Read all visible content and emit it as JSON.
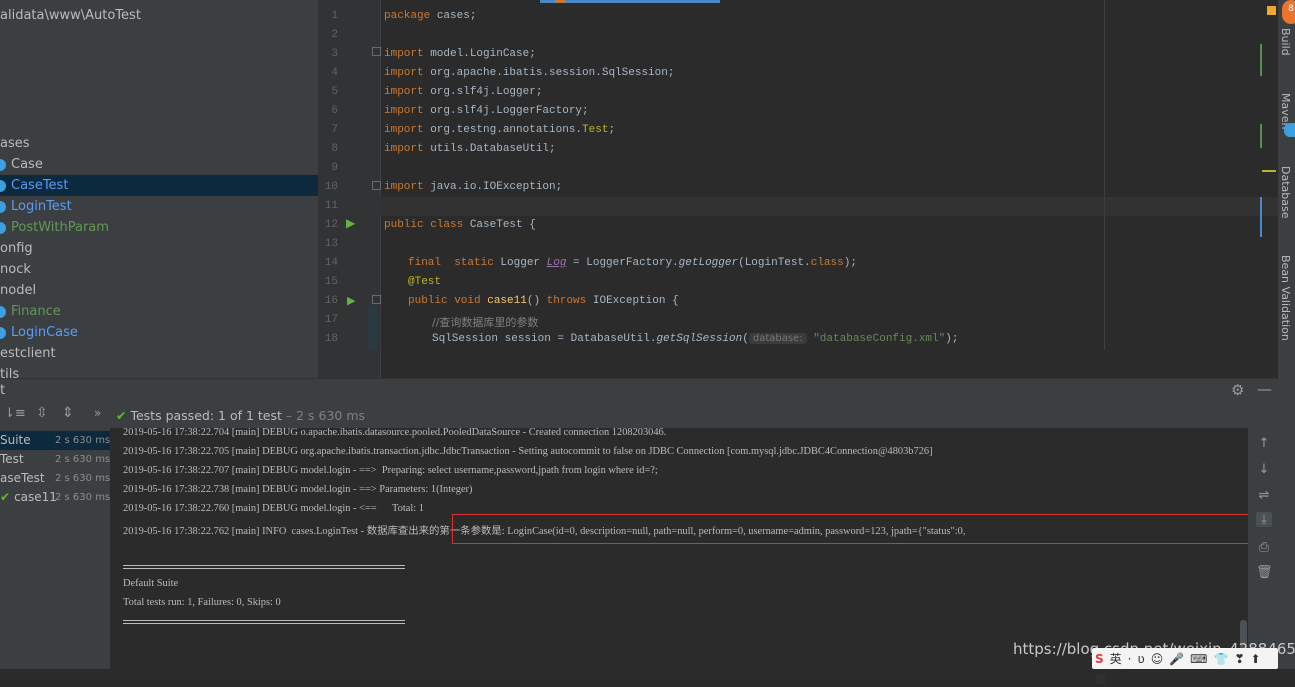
{
  "project": {
    "path": "alidata\\www\\AutoTest",
    "tree": [
      {
        "label": "ases",
        "style": "plain",
        "icon": false
      },
      {
        "label": "Case",
        "style": "plain",
        "icon": true
      },
      {
        "label": "CaseTest",
        "style": "blue",
        "icon": true,
        "selected": true
      },
      {
        "label": "LoginTest",
        "style": "blue",
        "icon": true
      },
      {
        "label": "PostWithParam",
        "style": "green",
        "icon": true
      },
      {
        "label": "onfig",
        "style": "plain",
        "icon": false
      },
      {
        "label": "nock",
        "style": "plain",
        "icon": false
      },
      {
        "label": "nodel",
        "style": "plain",
        "icon": false
      },
      {
        "label": "Finance",
        "style": "green",
        "icon": true
      },
      {
        "label": "LoginCase",
        "style": "blue",
        "icon": true
      },
      {
        "label": "estclient",
        "style": "plain",
        "icon": false
      },
      {
        "label": "tils",
        "style": "plain",
        "icon": false
      }
    ]
  },
  "editor": {
    "line_numbers": [
      "1",
      "2",
      "3",
      "4",
      "5",
      "6",
      "7",
      "8",
      "9",
      "10",
      "11",
      "12",
      "13",
      "14",
      "15",
      "16",
      "17",
      "18"
    ],
    "code": {
      "l1_kw": "package",
      "l1_rest": " cases;",
      "l3_kw": "import",
      "l3_rest": " model.LoginCase;",
      "l4_kw": "import",
      "l4_rest": " org.apache.ibatis.session.SqlSession;",
      "l5_kw": "import",
      "l5_rest": " org.slf4j.Logger;",
      "l6_kw": "import",
      "l6_rest": " org.slf4j.LoggerFactory;",
      "l7_kw": "import",
      "l7_rest": " org.testng.annotations.",
      "l7_ann": "Test",
      "l7_end": ";",
      "l8_kw": "import",
      "l8_rest": " utils.DatabaseUtil;",
      "l10_kw": "import",
      "l10_rest": " java.io.IOException;",
      "l12_kw": "public class",
      "l12_rest": " CaseTest {",
      "l14_kw": "final  static",
      "l14_a": " Logger ",
      "l14_var": "Log",
      "l14_b": " = LoggerFactory.",
      "l14_fn": "getLogger",
      "l14_c": "(LoginTest.",
      "l14_kw2": "class",
      "l14_d": ");",
      "l15_ann": "@Test",
      "l16_kw": "public void",
      "l16_fn": " case11",
      "l16_a": "() ",
      "l16_kw2": "throws",
      "l16_b": " IOException {",
      "l17_cmt": "//查询数据库里的参数",
      "l18_a": "SqlSession session = DatabaseUtil.",
      "l18_fn": "getSqlSession",
      "l18_b": "(",
      "l18_hint": "database:",
      "l18_str": " \"databaseConfig.xml\"",
      "l18_c": ");"
    }
  },
  "sidebar_right": {
    "badge": "8",
    "labels": [
      "Build",
      "Maven",
      "Database",
      "Bean Validation"
    ]
  },
  "run": {
    "header_tab": "t",
    "status_prefix": "Tests passed:",
    "status_count": "1 of 1 test",
    "status_time": "– 2 s 630 ms",
    "tree": [
      {
        "label": "Suite",
        "time": "2 s 630 ms",
        "selected": true
      },
      {
        "label": "Test",
        "time": "2 s 630 ms"
      },
      {
        "label": "aseTest",
        "time": "2 s 630 ms"
      },
      {
        "label": "case11",
        "time": "2 s 630 ms"
      }
    ],
    "log_lines": [
      "2019-05-16 17:38:22.704 [main] DEBUG o.apache.ibatis.datasource.pooled.PooledDataSource - Created connection 1208203046.",
      "2019-05-16 17:38:22.705 [main] DEBUG org.apache.ibatis.transaction.jdbc.JdbcTransaction - Setting autocommit to false on JDBC Connection [com.mysql.jdbc.JDBC4Connection@4803b726]",
      "2019-05-16 17:38:22.707 [main] DEBUG model.login - ==>  Preparing: select username,password,jpath from login where id=?;",
      "2019-05-16 17:38:22.738 [main] DEBUG model.login - ==> Parameters: 1(Integer)",
      "2019-05-16 17:38:22.760 [main] DEBUG model.login - <==      Total: 1",
      "2019-05-16 17:38:22.762 [main] INFO  cases.LoginTest - 数据库查出来的第一条参数是: LoginCase(id=0, description=null, path=null, perform=0, username=admin, password=123, jpath={\"status\":0,"
    ],
    "suite_title": "Default Suite",
    "suite_summary": "Total tests run: 1, Failures: 0, Skips: 0"
  },
  "watermark": "https://blog.csdn.net/weixin_42884654",
  "ime": {
    "items": [
      "S",
      "英",
      "·",
      "ʋ",
      "☺",
      "🎤",
      "⌨",
      "👕",
      "❣",
      "⬆",
      "▦"
    ]
  }
}
